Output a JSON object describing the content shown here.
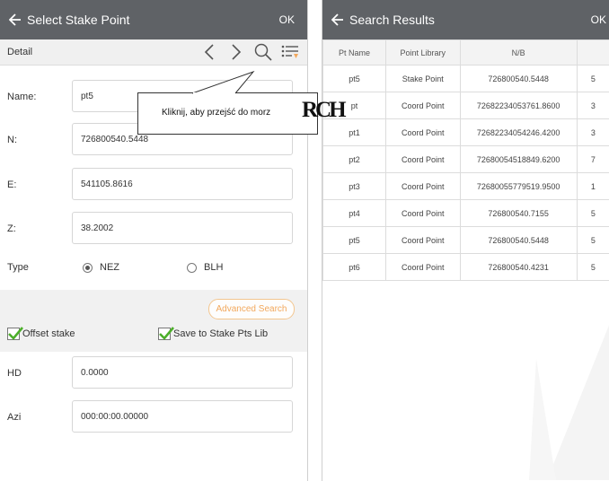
{
  "left": {
    "title": "Select Stake Point",
    "ok": "OK",
    "subbar": {
      "label": "Detail"
    },
    "fields": {
      "name": {
        "label": "Name:",
        "value": "pt5"
      },
      "n": {
        "label": "N:",
        "value": "726800540.5448"
      },
      "e": {
        "label": "E:",
        "value": "541105.8616"
      },
      "z": {
        "label": "Z:",
        "value": "38.2002"
      }
    },
    "type": {
      "label": "Type",
      "options": [
        "NEZ",
        "BLH"
      ],
      "selected": "NEZ"
    },
    "advanced_search": "Advanced Search",
    "offset_stake": "Offset stake",
    "save_to_lib": "Save to Stake Pts Lib",
    "hd": {
      "label": "HD",
      "value": "0.0000"
    },
    "azi": {
      "label": "Azi",
      "value": "000:00:00.00000"
    }
  },
  "callout": {
    "text": "Kliknij, aby przejść do morz",
    "logo": "RCH"
  },
  "right": {
    "title": "Search Results",
    "ok": "OK",
    "columns": [
      "Pt Name",
      "Point Library",
      "N/B",
      ""
    ],
    "rows": [
      [
        "pt5",
        "Stake Point",
        "726800540.5448",
        "5"
      ],
      [
        "pt",
        "Coord Point",
        "72682234053761.8600",
        "3"
      ],
      [
        "pt1",
        "Coord Point",
        "72682234054246.4200",
        "3"
      ],
      [
        "pt2",
        "Coord Point",
        "72680054518849.6200",
        "7"
      ],
      [
        "pt3",
        "Coord Point",
        "72680055779519.9500",
        "1"
      ],
      [
        "pt4",
        "Coord Point",
        "726800540.7155",
        "5"
      ],
      [
        "pt5",
        "Coord Point",
        "726800540.5448",
        "5"
      ],
      [
        "pt6",
        "Coord Point",
        "726800540.4231",
        "5"
      ]
    ]
  },
  "colors": {
    "titlebar": "#5f6266",
    "accent_orange": "#f2a85c",
    "check_green": "#4caf2a"
  }
}
